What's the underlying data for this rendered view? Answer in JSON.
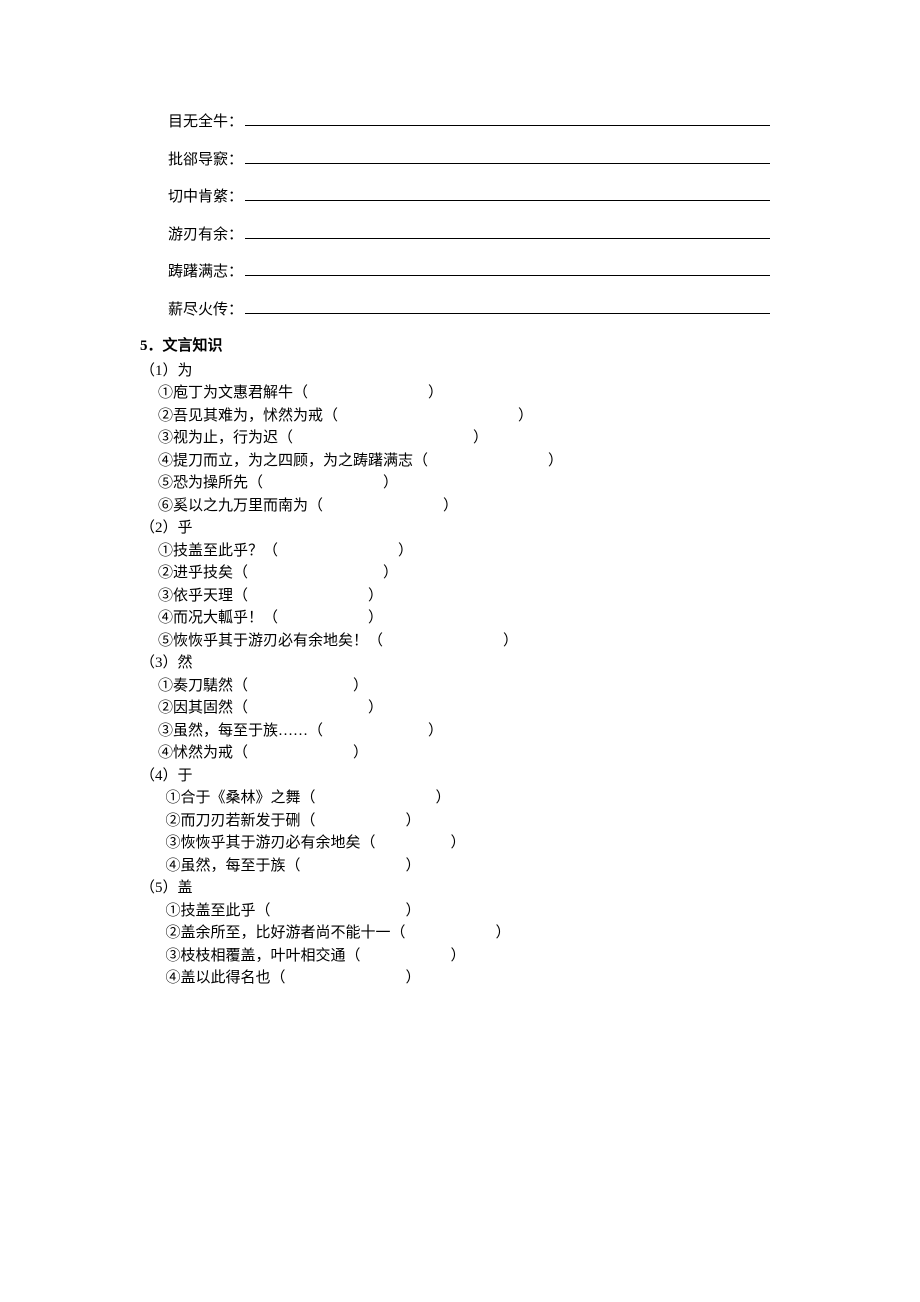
{
  "fill_terms": [
    "目无全牛：",
    "批郤导窾：",
    "切中肯綮：",
    "游刃有余：",
    "踌躇满志：",
    "薪尽火传："
  ],
  "section5": {
    "number": "5．",
    "title": "文言知识"
  },
  "groups": [
    {
      "label": "（1）为",
      "items": [
        "①庖丁为文惠君解牛（　　　　　　　　）",
        "②吾见其难为，怵然为戒（　　　　　　　　　　　　）",
        "③视为止，行为迟（　　　　　　　　　　　　）",
        "④提刀而立，为之四顾，为之踌躇满志（　　　　　　　　）",
        "⑤恐为操所先（　　　　　　　　）",
        "⑥奚以之九万里而南为（　　　　　　　　）"
      ]
    },
    {
      "label": "（2）乎",
      "items": [
        "①技盖至此乎？（　　　　　　　　）",
        "②进乎技矣（　　　　　　　　　）",
        "③依乎天理（　　　　　　　　）",
        "④而况大軱乎！（　　　　　　）",
        "⑤恢恢乎其于游刃必有余地矣！（　　　　　　　　）"
      ]
    },
    {
      "label": "（3）然",
      "items": [
        "①奏刀騞然（　　　　　　　）",
        "②因其固然（　　　　　　　　）",
        "③虽然，每至于族……（　　　　　　　）",
        "④怵然为戒（　　　　　　　）"
      ]
    },
    {
      "label": "（4）于",
      "items": [
        "  ①合于《桑林》之舞（　　　　　　　　）",
        "  ②而刀刃若新发于硎（　　　　　　）",
        "  ③恢恢乎其于游刃必有余地矣（　　　　　）",
        "  ④虽然，每至于族（　　　　　　　）"
      ]
    },
    {
      "label": "（5）盖",
      "items": [
        "  ①技盖至此乎（　　　　　　　　　）",
        "  ②盖余所至，比好游者尚不能十一（　　　　　　）",
        "  ③枝枝相覆盖，叶叶相交通（　　　　　　）",
        "  ④盖以此得名也（　　　　　　　　）"
      ]
    }
  ]
}
